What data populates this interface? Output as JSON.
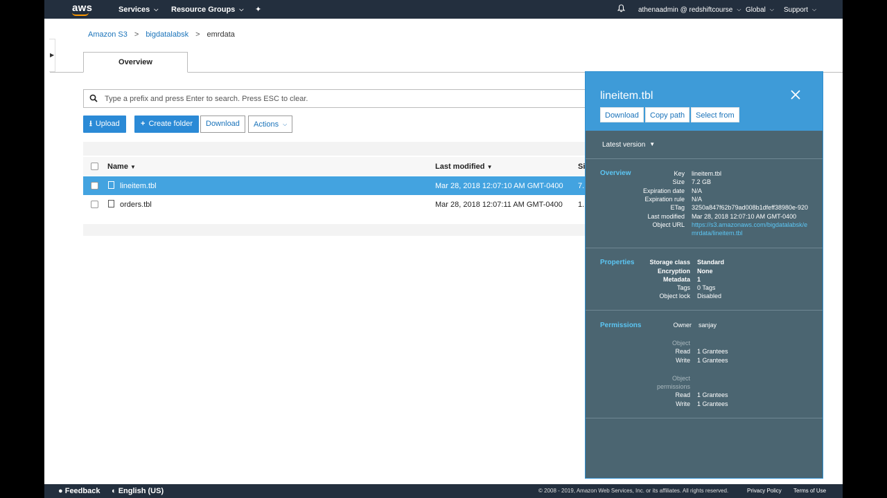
{
  "topnav": {
    "logo": "aws",
    "services": "Services",
    "resource_groups": "Resource Groups",
    "account": "athenaadmin @ redshiftcourse",
    "region": "Global",
    "support": "Support"
  },
  "breadcrumb": {
    "items": [
      "Amazon S3",
      "bigdatalabsk",
      "emrdata"
    ]
  },
  "tabs": {
    "overview": "Overview"
  },
  "search": {
    "placeholder": "Type a prefix and press Enter to search. Press ESC to clear."
  },
  "toolbar": {
    "upload": "Upload",
    "create_folder": "Create folder",
    "download": "Download",
    "actions": "Actions"
  },
  "table": {
    "headers": {
      "name": "Name",
      "last_modified": "Last modified",
      "size": "Si"
    },
    "rows": [
      {
        "name": "lineitem.tbl",
        "last_modified": "Mar 28, 2018 12:07:10 AM GMT-0400",
        "size": "7.",
        "selected": true
      },
      {
        "name": "orders.tbl",
        "last_modified": "Mar 28, 2018 12:07:11 AM GMT-0400",
        "size": "1.",
        "selected": false
      }
    ]
  },
  "panel": {
    "title": "lineitem.tbl",
    "buttons": {
      "download": "Download",
      "copy_path": "Copy path",
      "select_from": "Select from"
    },
    "version": "Latest version",
    "overview": {
      "heading": "Overview",
      "key_label": "Key",
      "key": "lineitem.tbl",
      "size_label": "Size",
      "size": "7.2 GB",
      "exp_date_label": "Expiration date",
      "exp_date": "N/A",
      "exp_rule_label": "Expiration rule",
      "exp_rule": "N/A",
      "etag_label": "ETag",
      "etag": "3250a847f62b79ad008b1dfeff38980e-920",
      "last_modified_label": "Last modified",
      "last_modified": "Mar 28, 2018 12:07:10 AM GMT-0400",
      "url_label": "Object URL",
      "url_line1": "https://s3.amazonaws.com/bigdatalabsk/e",
      "url_line2": "mrdata/lineitem.tbl"
    },
    "properties": {
      "heading": "Properties",
      "storage_label": "Storage class",
      "storage": "Standard",
      "encryption_label": "Encryption",
      "encryption": "None",
      "metadata_label": "Metadata",
      "metadata": "1",
      "tags_label": "Tags",
      "tags": "0 Tags",
      "lock_label": "Object lock",
      "lock": "Disabled"
    },
    "permissions": {
      "heading": "Permissions",
      "owner_label": "Owner",
      "owner": "sanjay",
      "object_group": "Object",
      "read_label": "Read",
      "read": "1 Grantees",
      "write_label": "Write",
      "write": "1 Grantees",
      "objperm_group_1": "Object",
      "objperm_group_2": "permissions",
      "read2_label": "Read",
      "read2": "1 Grantees",
      "write2_label": "Write",
      "write2": "1 Grantees"
    }
  },
  "footer": {
    "feedback": "Feedback",
    "language": "English (US)",
    "copyright": "© 2008 - 2019, Amazon Web Services, Inc. or its affiliates. All rights reserved.",
    "privacy": "Privacy Policy",
    "terms": "Terms of Use"
  },
  "colors": {
    "nav_bg": "#232f3e",
    "accent_blue": "#2b8ad6",
    "selected_row": "#43a3e0",
    "panel_bg": "#4b6571",
    "panel_header": "#3e9bd8",
    "section_heading": "#5cc6f4",
    "aws_orange": "#ff9900"
  }
}
